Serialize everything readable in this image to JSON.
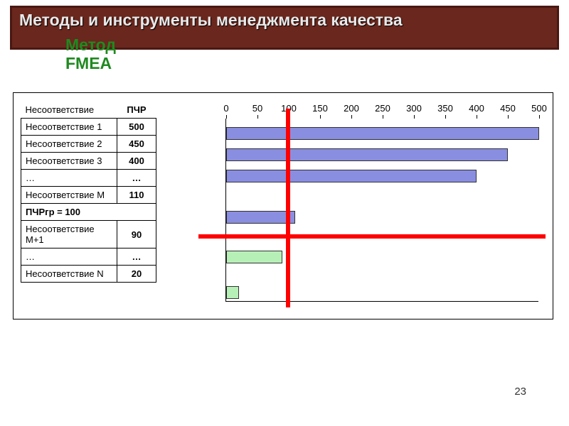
{
  "title": "Методы и инструменты менеджмента качества",
  "subtitle_line1": "Метод",
  "subtitle_line2": "FMEA",
  "page_number": "23",
  "table": {
    "header_label": "Несоответствие",
    "header_value": "ПЧР",
    "rows": [
      {
        "label": "Несоответствие 1",
        "value": "500"
      },
      {
        "label": "Несоответствие 2",
        "value": "450"
      },
      {
        "label": "Несоответствие 3",
        "value": "400"
      },
      {
        "label": "…",
        "value": "…"
      },
      {
        "label": "Несоответствие М",
        "value": "110"
      }
    ],
    "threshold_row": "ПЧРгр = 100",
    "rows_after": [
      {
        "label": "Несоответствие М+1",
        "value": "90"
      },
      {
        "label": "…",
        "value": "…"
      },
      {
        "label": "Несоответствие N",
        "value": "20"
      }
    ]
  },
  "chart_data": {
    "type": "bar",
    "orientation": "horizontal",
    "xlim": [
      0,
      500
    ],
    "ticks": [
      0,
      50,
      100,
      150,
      200,
      250,
      300,
      350,
      400,
      450,
      500
    ],
    "threshold_x": 100,
    "threshold_y_between": [
      "Несоответствие М",
      "Несоответствие М+1"
    ],
    "series": [
      {
        "name": "above_threshold",
        "color": "#8a8ee0",
        "items": [
          {
            "label": "Несоответствие 1",
            "value": 500
          },
          {
            "label": "Несоответствие 2",
            "value": 450
          },
          {
            "label": "Несоответствие 3",
            "value": 400
          },
          {
            "label": "Несоответствие М",
            "value": 110
          }
        ]
      },
      {
        "name": "below_threshold",
        "color": "#b7f0b7",
        "items": [
          {
            "label": "Несоответствие М+1",
            "value": 90
          },
          {
            "label": "Несоответствие N",
            "value": 20
          }
        ]
      }
    ]
  }
}
